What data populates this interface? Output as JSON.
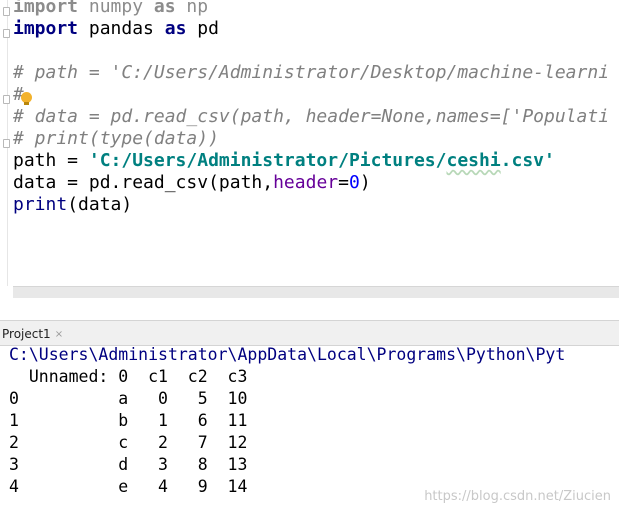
{
  "editor": {
    "lines": [
      {
        "parts": [
          {
            "t": "import",
            "c": "kw-dim"
          },
          {
            "t": " numpy ",
            "c": "dim"
          },
          {
            "t": "as",
            "c": "kw-dim"
          },
          {
            "t": " np",
            "c": "dim"
          }
        ]
      },
      {
        "parts": [
          {
            "t": "import",
            "c": "kw"
          },
          {
            "t": " pandas ",
            "c": ""
          },
          {
            "t": "as",
            "c": "kw"
          },
          {
            "t": " pd",
            "c": ""
          }
        ]
      },
      {
        "parts": []
      },
      {
        "parts": [
          {
            "t": "# path = 'C:/Users/Administrator/Desktop/machine-learni",
            "c": "cmt"
          }
        ]
      },
      {
        "parts": [
          {
            "t": "#",
            "c": "cmt"
          }
        ]
      },
      {
        "parts": [
          {
            "t": "# data = pd.read_csv(path, header=None,names=['Populati",
            "c": "cmt"
          }
        ]
      },
      {
        "parts": [
          {
            "t": "# print(type(data))",
            "c": "cmt"
          }
        ]
      },
      {
        "parts": [
          {
            "t": "path = ",
            "c": ""
          },
          {
            "t": "'C:/Users/Administrator/Pictures/",
            "c": "str"
          },
          {
            "t": "ceshi",
            "c": "str str-path"
          },
          {
            "t": ".csv'",
            "c": "str"
          }
        ]
      },
      {
        "parts": [
          {
            "t": "data = pd.read_csv(path,",
            "c": ""
          },
          {
            "t": "header",
            "c": "param"
          },
          {
            "t": "=",
            "c": ""
          },
          {
            "t": "0",
            "c": "num"
          },
          {
            "t": ")",
            "c": ""
          }
        ]
      },
      {
        "parts": [
          {
            "t": "print",
            "c": "builtin"
          },
          {
            "t": "(data)",
            "c": ""
          }
        ]
      }
    ]
  },
  "run_tab": {
    "label": "Project1",
    "close": "×"
  },
  "console": {
    "command": "C:\\Users\\Administrator\\AppData\\Local\\Programs\\Python\\Pyt",
    "output": [
      "  Unnamed: 0  c1  c2  c3",
      "0          a   0   5  10",
      "1          b   1   6  11",
      "2          c   2   7  12",
      "3          d   3   8  13",
      "4          e   4   9  14"
    ]
  },
  "watermark": "https://blog.csdn.net/Ziucien",
  "icons": {
    "intention": "lightbulb-icon",
    "fold": "fold-marker-icon"
  }
}
